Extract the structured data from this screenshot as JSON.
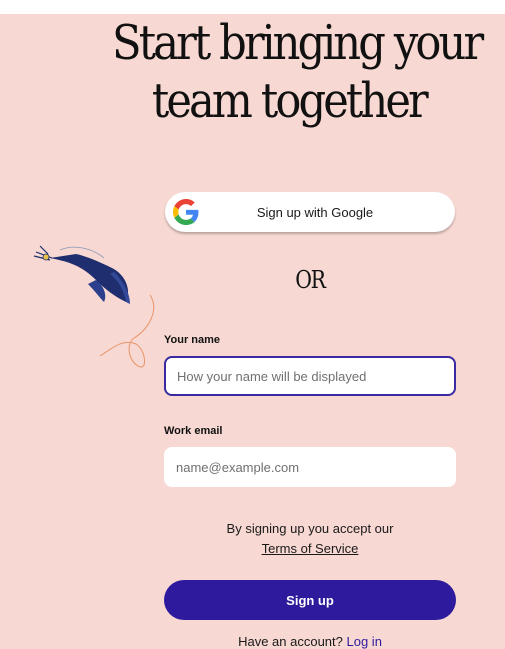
{
  "headline": {
    "line1": "Start bringing your",
    "line2": "team together"
  },
  "google": {
    "label": "Sign up with Google",
    "icon": "google-g-icon"
  },
  "divider": "OR",
  "form": {
    "name_label": "Your name",
    "name_placeholder": "How your name will be displayed",
    "email_label": "Work email",
    "email_placeholder": "name@example.com"
  },
  "terms": {
    "prefix": "By signing up you accept our",
    "link": "Terms of Service"
  },
  "signup_label": "Sign up",
  "login": {
    "prompt": "Have an account?",
    "link": "Log in"
  },
  "colors": {
    "background": "#f7d8d2",
    "primary": "#2e1a9c",
    "illustration": "#1f2e6e",
    "accent_line": "#e8956a"
  }
}
